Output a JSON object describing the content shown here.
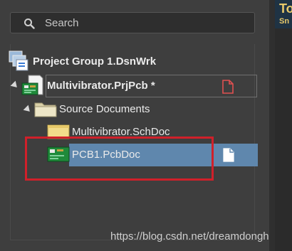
{
  "search": {
    "placeholder": "Search"
  },
  "tree": {
    "project_group": {
      "label": "Project Group 1.DsnWrk"
    },
    "project": {
      "label": "Multivibrator.PrjPcb *"
    },
    "folder": {
      "label": "Source Documents"
    },
    "documents": [
      {
        "label": "Multivibrator.SchDoc"
      },
      {
        "label": "PCB1.PcbDoc"
      }
    ]
  },
  "right_pane": {
    "title": "To",
    "subtitle": "Sn"
  },
  "watermark": "https://blog.csdn.net/dreamdonghui",
  "colors": {
    "selection": "#5f87ad",
    "annotation": "#d0202a",
    "modified_icon": "#e05050"
  }
}
